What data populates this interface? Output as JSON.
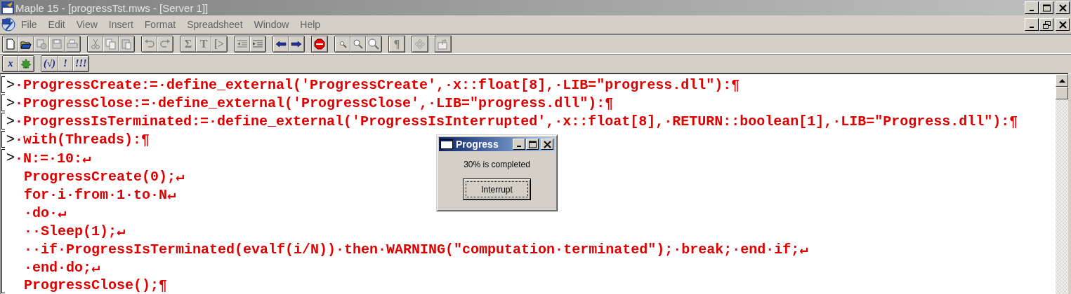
{
  "window": {
    "title": "Maple 15  - [progressTst.mws - [Server 1]]"
  },
  "menu": [
    {
      "label": "File"
    },
    {
      "label": "Edit"
    },
    {
      "label": "View"
    },
    {
      "label": "Insert"
    },
    {
      "label": "Format"
    },
    {
      "label": "Spreadsheet"
    },
    {
      "label": "Window"
    },
    {
      "label": "Help"
    }
  ],
  "toolbar_glyphs": [
    "Σ",
    "T",
    "[>",
    "¶"
  ],
  "toolbar2_glyphs": [
    "x",
    "(√)",
    "!",
    "!!!"
  ],
  "worksheet": {
    "groups": [
      {
        "prompt": ">",
        "lines": [
          "·ProgressCreate:=·define_external('ProgressCreate',·x::float[8],·LIB=\"progress.dll\"):¶"
        ]
      },
      {
        "prompt": ">",
        "lines": [
          "·ProgressClose:=·define_external('ProgressClose',·LIB=\"progress.dll\"):¶"
        ]
      },
      {
        "prompt": ">",
        "lines": [
          "·ProgressIsTerminated:=·define_external('ProgressIsInterrupted',·x::float[8],·RETURN::boolean[1],·LIB=\"Progress.dll\"):¶"
        ]
      },
      {
        "prompt": ">",
        "lines": [
          "·with(Threads):¶"
        ]
      },
      {
        "prompt": ">",
        "lines": [
          "·N:=·10:↵",
          "ProgressCreate(0);↵",
          "for·i·from·1·to·N↵",
          "·do·↵",
          "··Sleep(1);↵",
          "··if·ProgressIsTerminated(evalf(i/N))·then·WARNING(\"computation·terminated\");·break;·end·if;↵",
          "·end·do;↵",
          "ProgressClose();¶"
        ]
      }
    ]
  },
  "dialog": {
    "title": "Progress",
    "message": "30% is completed",
    "button": "Interrupt"
  }
}
